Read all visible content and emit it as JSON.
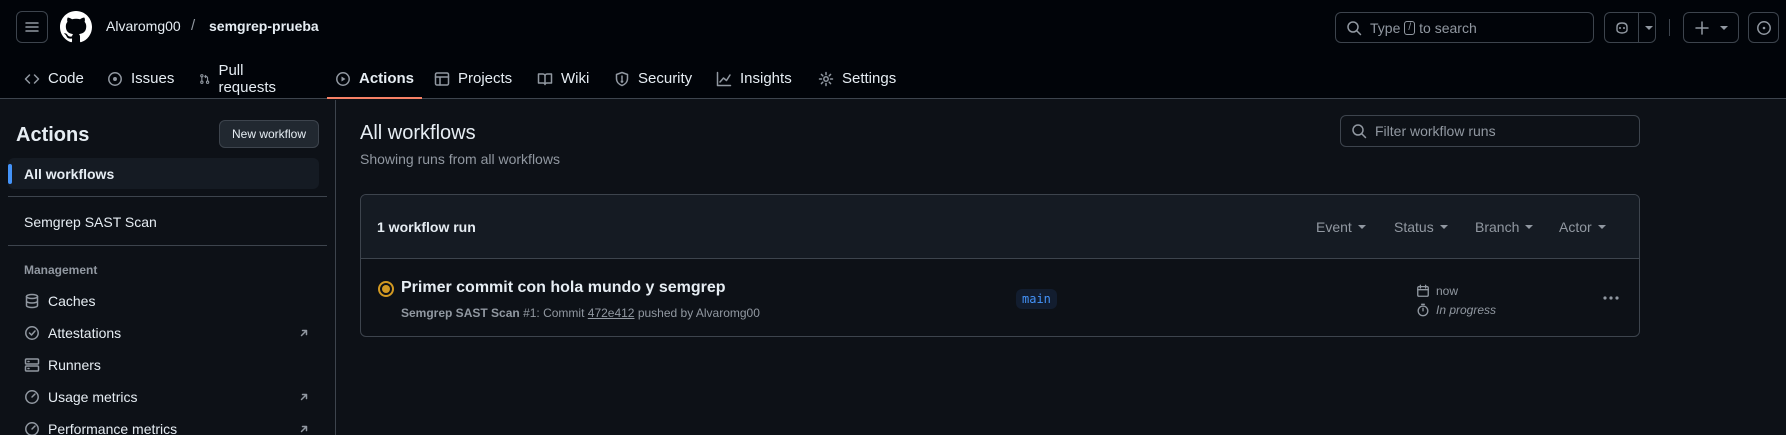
{
  "header": {
    "owner": "Alvaromg00",
    "separator": "/",
    "repo": "semgrep-prueba",
    "search": {
      "before": "Type",
      "key": "/",
      "after": "to search"
    }
  },
  "nav": {
    "items": [
      {
        "label": "Code",
        "icon": "code-icon"
      },
      {
        "label": "Issues",
        "icon": "issue-icon"
      },
      {
        "label": "Pull requests",
        "icon": "pull-request-icon"
      },
      {
        "label": "Actions",
        "icon": "play-icon",
        "active": true
      },
      {
        "label": "Projects",
        "icon": "table-icon"
      },
      {
        "label": "Wiki",
        "icon": "book-icon"
      },
      {
        "label": "Security",
        "icon": "shield-icon"
      },
      {
        "label": "Insights",
        "icon": "graph-icon"
      },
      {
        "label": "Settings",
        "icon": "gear-icon"
      }
    ]
  },
  "sidebar": {
    "title": "Actions",
    "new_workflow": "New workflow",
    "all_workflows": "All workflows",
    "workflows": [
      "Semgrep SAST Scan"
    ],
    "section": "Management",
    "management": [
      {
        "label": "Caches",
        "icon": "database-icon",
        "external": false
      },
      {
        "label": "Attestations",
        "icon": "verified-icon",
        "external": true
      },
      {
        "label": "Runners",
        "icon": "server-icon",
        "external": false
      },
      {
        "label": "Usage metrics",
        "icon": "meter-icon",
        "external": true
      },
      {
        "label": "Performance metrics",
        "icon": "meter-icon",
        "external": true
      }
    ]
  },
  "main": {
    "title": "All workflows",
    "subtitle": "Showing runs from all workflows",
    "filter_placeholder": "Filter workflow runs",
    "count": "1 workflow run",
    "filters": [
      "Event",
      "Status",
      "Branch",
      "Actor"
    ],
    "run": {
      "title": "Primer commit con hola mundo y semgrep",
      "workflow": "Semgrep SAST Scan",
      "number": "#1",
      "commit_prefix": ": Commit",
      "commit": "472e412",
      "pushed_by": "pushed by Alvaromg00",
      "branch": "main",
      "when": "now",
      "status": "In progress",
      "status_color": "#d29922"
    }
  },
  "colors": {
    "accent": "#4493f8",
    "active_tab": "#f78166",
    "in_progress": "#d29922"
  }
}
